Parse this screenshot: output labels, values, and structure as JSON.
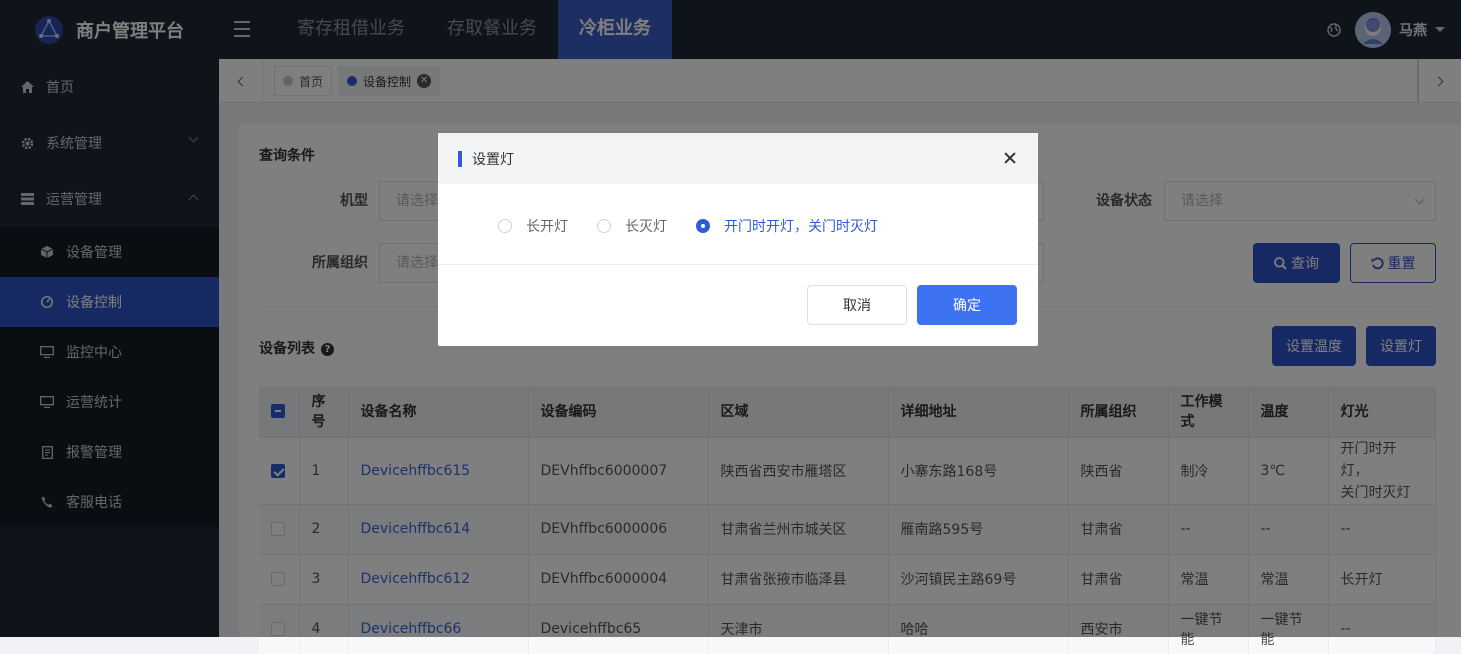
{
  "app": {
    "title": "商户管理平台"
  },
  "topnav": {
    "items": [
      {
        "label": "寄存租借业务"
      },
      {
        "label": "存取餐业务"
      },
      {
        "label": "冷柜业务"
      }
    ]
  },
  "user": {
    "name": "马燕"
  },
  "sidebar": {
    "home": "首页",
    "system": "系统管理",
    "ops": "运营管理",
    "sub": [
      "设备管理",
      "设备控制",
      "监控中心",
      "运营统计",
      "报警管理",
      "客服电话"
    ]
  },
  "tabs": [
    {
      "label": "首页"
    },
    {
      "label": "设备控制"
    }
  ],
  "query": {
    "title": "查询条件",
    "model_label": "机型",
    "model_placeholder": "请选择",
    "org_label": "所属组织",
    "org_placeholder": "请选择",
    "status_label": "设备状态",
    "status_placeholder": "请选择",
    "search_btn": "查询",
    "reset_btn": "重置"
  },
  "list": {
    "title": "设备列表",
    "set_temp_btn": "设置温度",
    "set_light_btn": "设置灯"
  },
  "table": {
    "columns": [
      "序号",
      "设备名称",
      "设备编码",
      "区域",
      "详细地址",
      "所属组织",
      "工作模式",
      "温度",
      "灯光"
    ],
    "rows": [
      {
        "no": "1",
        "name": "Devicehffbc615",
        "code": "DEVhffbc6000007",
        "region": "陕西省西安市雁塔区",
        "address": "小寨东路168号",
        "org": "陕西省",
        "mode": "制冷",
        "temp": "3℃",
        "light_1": "开门时开灯，",
        "light_2": "关门时灭灯",
        "checked": true
      },
      {
        "no": "2",
        "name": "Devicehffbc614",
        "code": "DEVhffbc6000006",
        "region": "甘肃省兰州市城关区",
        "address": "雁南路595号",
        "org": "甘肃省",
        "mode": "--",
        "temp": "--",
        "light": "--",
        "checked": false
      },
      {
        "no": "3",
        "name": "Devicehffbc612",
        "code": "DEVhffbc6000004",
        "region": "甘肃省张掖市临泽县",
        "address": "沙河镇民主路69号",
        "org": "甘肃省",
        "mode": "常温",
        "temp": "常温",
        "light": "长开灯",
        "checked": false
      },
      {
        "no": "4",
        "name": "Devicehffbc66",
        "code": "Devicehffbc65",
        "region": "天津市",
        "address": "哈哈",
        "org": "西安市",
        "mode": "一键节能",
        "temp": "一键节能",
        "light": "--",
        "checked": false
      }
    ]
  },
  "modal": {
    "title": "设置灯",
    "options": [
      "长开灯",
      "长灭灯",
      "开门时开灯，关门时灭灯"
    ],
    "selected_index": 2,
    "cancel": "取消",
    "ok": "确定"
  },
  "colors": {
    "primary": "#2f53c5",
    "sidebar_bg": "#1f2735",
    "modal_ok": "#3d73f0"
  }
}
